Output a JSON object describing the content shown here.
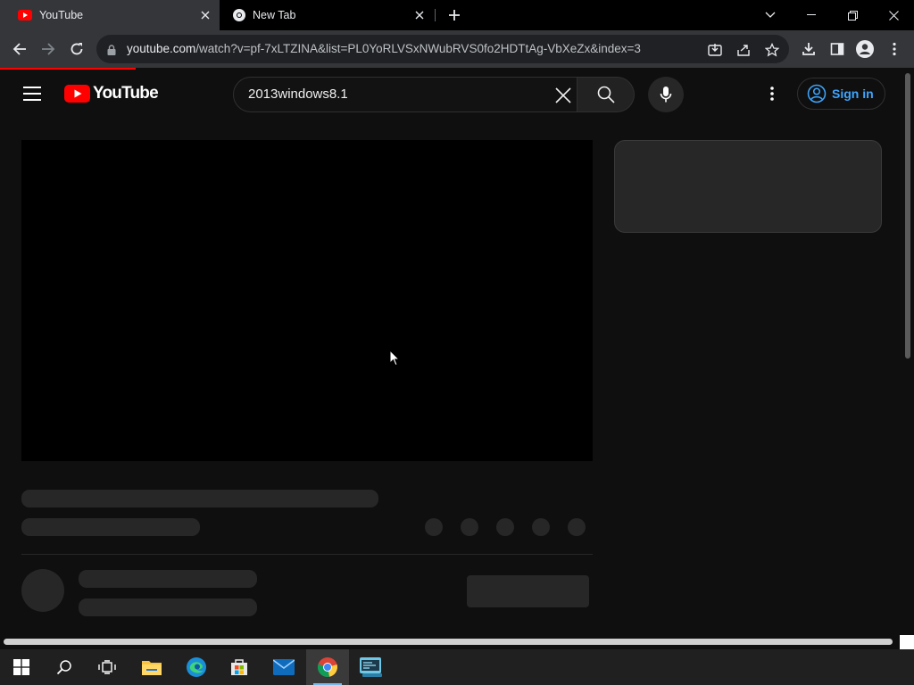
{
  "browser": {
    "tabs": [
      {
        "title": "YouTube",
        "active": true
      },
      {
        "title": "New Tab",
        "active": false
      }
    ],
    "address": {
      "host": "youtube.com",
      "path": "/watch?v=pf-7xLTZINA&list=PL0YoRLVSxNWubRVS0fo2HDTtAg-VbXeZx&index=3"
    }
  },
  "youtube": {
    "logo_text": "YouTube",
    "search_query": "2013windows8.1",
    "sign_in_label": "Sign in"
  },
  "colors": {
    "brand_red": "#ff0000",
    "link_blue": "#3ea6ff",
    "page_bg": "#0f0f0f",
    "chrome_bg": "#35363a"
  },
  "icons": {
    "taskbar": [
      "windows-start-icon",
      "search-icon",
      "task-view-icon",
      "file-explorer-icon",
      "edge-icon",
      "microsoft-store-icon",
      "mail-icon",
      "chrome-icon",
      "app-icon"
    ]
  }
}
